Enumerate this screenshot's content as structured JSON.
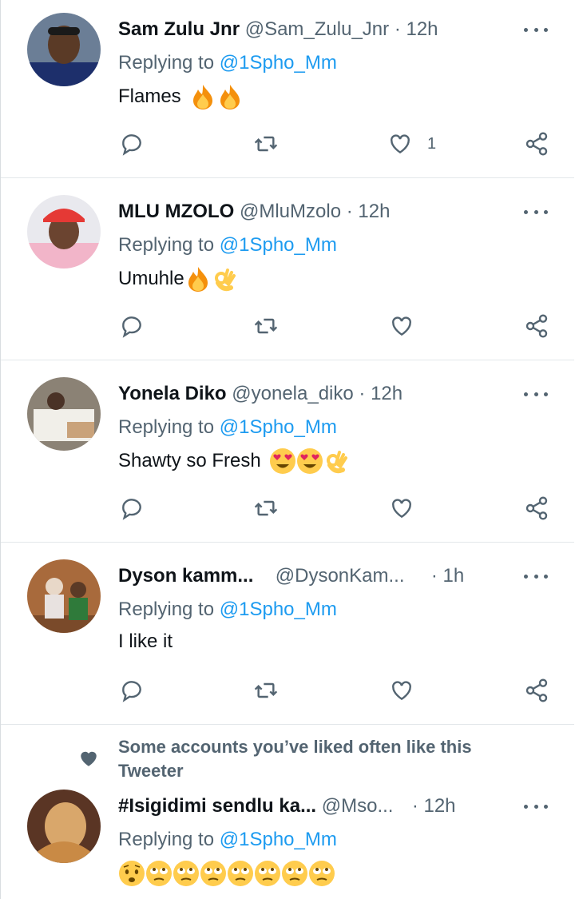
{
  "tweets": [
    {
      "name": "Sam Zulu Jnr",
      "handle": "@Sam_Zulu_Jnr",
      "time": "· 12h",
      "replying_prefix": "Replying to",
      "replying_to": "@1Spho_Mm",
      "text": "Flames",
      "emojis": [
        "fire",
        "fire"
      ],
      "likes": "1",
      "avatar_colors": {
        "bg": "#6b7e96",
        "shirt": "#1d2f6b",
        "skin": "#5a3a26"
      }
    },
    {
      "name": "MLU MZOLO",
      "handle": "@MluMzolo",
      "time": "· 12h",
      "replying_prefix": "Replying to",
      "replying_to": "@1Spho_Mm",
      "text": "Umuhle",
      "emojis": [
        "fire",
        "ok-hand"
      ],
      "likes": "",
      "avatar_colors": {
        "bg": "#e9e9ee",
        "shirt": "#f2b5c9",
        "skin": "#6b4430"
      }
    },
    {
      "name": "Yonela Diko",
      "handle": "@yonela_diko",
      "time": "· 12h",
      "replying_prefix": "Replying to",
      "replying_to": "@1Spho_Mm",
      "text": "Shawty so Fresh",
      "emojis": [
        "heart-eyes",
        "heart-eyes",
        "ok-hand"
      ],
      "likes": "",
      "avatar_colors": {
        "bg": "#8b8275",
        "shirt": "#f1efe9",
        "skin": "#4a3226"
      }
    },
    {
      "name": "Dyson kamm...",
      "handle": "@DysonKam...",
      "time": "· 1h",
      "replying_prefix": "Replying to",
      "replying_to": "@1Spho_Mm",
      "text": "I like it",
      "emojis": [],
      "likes": "",
      "avatar_colors": {
        "bg": "#a86a3c",
        "shirt": "#2f7a3a",
        "skin": "#5b3a26"
      }
    }
  ],
  "social_context": "Some accounts you’ve liked often like this Tweeter",
  "last_tweet": {
    "name": "#Isigidimi sendlu ka...",
    "handle": "@Mso...",
    "time": "· 12h",
    "replying_prefix": "Replying to",
    "replying_to": "@1Spho_Mm",
    "emojis": [
      "anxious",
      "eye-roll",
      "eye-roll",
      "eye-roll",
      "eye-roll",
      "eye-roll",
      "eye-roll"
    ],
    "avatar_colors": {
      "bg": "#5a3524",
      "shirt": "#c98a45",
      "skin": "#d9a76b"
    }
  },
  "colors": {
    "link": "#1d9bf0",
    "secondary": "#536471",
    "text": "#0f1419"
  }
}
